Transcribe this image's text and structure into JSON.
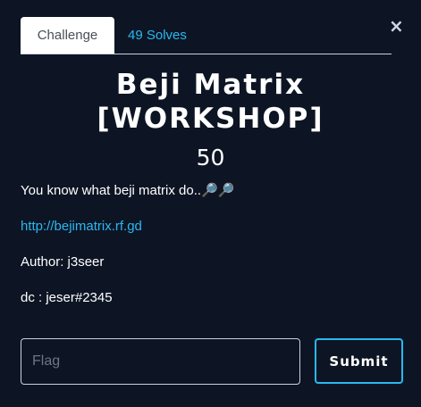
{
  "modal": {
    "close_glyph": "×"
  },
  "tabs": {
    "challenge_label": "Challenge",
    "solves_label": "49 Solves"
  },
  "challenge": {
    "title_line1": "Beji Matrix",
    "title_line2": "[WORKSHOP]",
    "value": "50",
    "description": "You know what beji matrix do..🔎🔎",
    "link": "http://bejimatrix.rf.gd",
    "author": "Author: j3seer",
    "dc": "dc : jeser#2345"
  },
  "form": {
    "flag_placeholder": "Flag",
    "submit_label": "Submit"
  },
  "colors": {
    "background": "#0d1524",
    "accent": "#2bb8f0"
  }
}
